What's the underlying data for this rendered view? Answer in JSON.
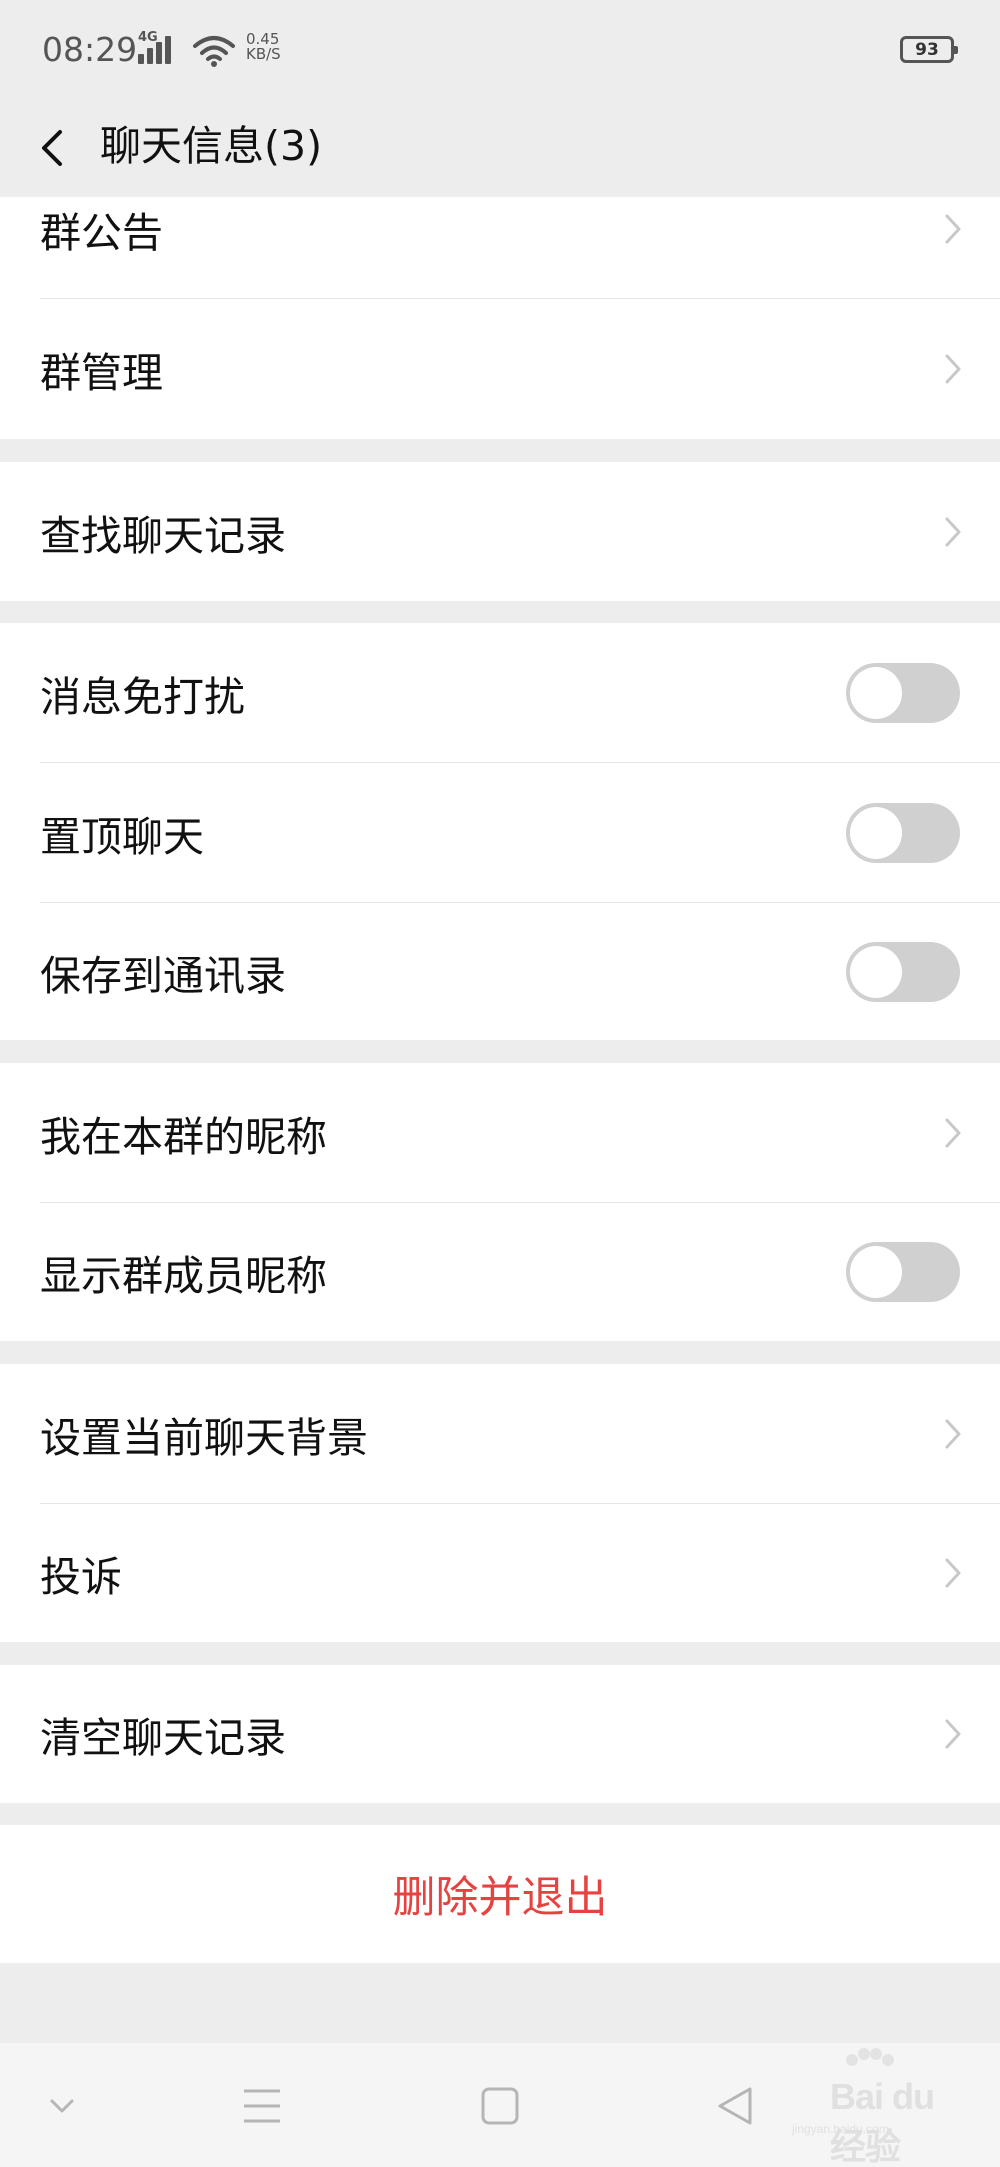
{
  "status_bar": {
    "time": "08:29",
    "network_type": "4G",
    "net_speed_value": "0.45",
    "net_speed_unit": "KB/S",
    "battery": "93"
  },
  "header": {
    "title": "聊天信息(3)"
  },
  "settings_groups": [
    [
      {
        "label": "群公告",
        "control": "chevron"
      },
      {
        "label": "群管理",
        "control": "chevron"
      }
    ],
    [
      {
        "label": "查找聊天记录",
        "control": "chevron"
      }
    ],
    [
      {
        "label": "消息免打扰",
        "control": "toggle",
        "on": false
      },
      {
        "label": "置顶聊天",
        "control": "toggle",
        "on": false
      },
      {
        "label": "保存到通讯录",
        "control": "toggle",
        "on": false
      }
    ],
    [
      {
        "label": "我在本群的昵称",
        "control": "chevron"
      },
      {
        "label": "显示群成员昵称",
        "control": "toggle",
        "on": false
      }
    ],
    [
      {
        "label": "设置当前聊天背景",
        "control": "chevron"
      },
      {
        "label": "投诉",
        "control": "chevron"
      }
    ],
    [
      {
        "label": "清空聊天记录",
        "control": "chevron"
      }
    ]
  ],
  "danger_button": {
    "label": "删除并退出",
    "color": "#e64340"
  },
  "watermark": {
    "text": "Bai du 经验",
    "sub": "jingyan.baidu.com"
  },
  "colors": {
    "background": "#ededed",
    "toggle_off": "#d0d0d0"
  }
}
